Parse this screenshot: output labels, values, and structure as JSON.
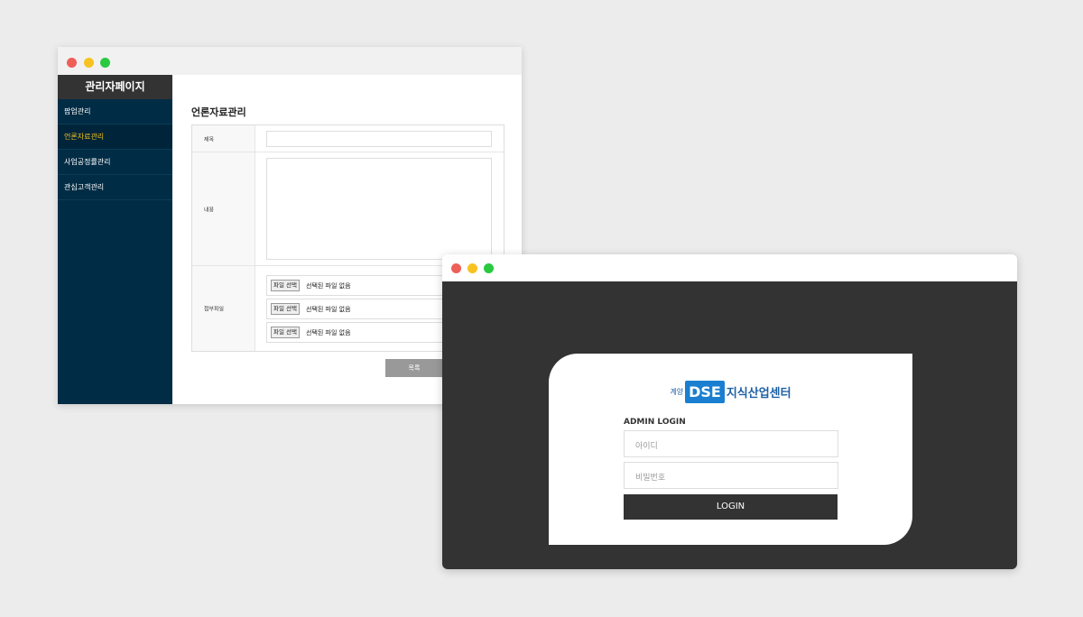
{
  "colors": {
    "dot_red": "#ee5f57",
    "dot_yellow": "#f8c220",
    "dot_green": "#29c940",
    "sidebar_bg": "#012c45",
    "active_menu": "#f6c21a"
  },
  "admin": {
    "sidebar": {
      "title": "관리자페이지",
      "items": [
        {
          "label": "팝업관리",
          "active": false
        },
        {
          "label": "언론자료관리",
          "active": true
        },
        {
          "label": "사업공정률관리",
          "active": false
        },
        {
          "label": "관심고객관리",
          "active": false
        }
      ]
    },
    "page_title": "언론자료관리",
    "form": {
      "title_label": "제목",
      "content_label": "내용",
      "attach_label": "첨부파일",
      "files": [
        {
          "button": "파일 선택",
          "status": "선택된 파일 없음"
        },
        {
          "button": "파일 선택",
          "status": "선택된 파일 없음"
        },
        {
          "button": "파일 선택",
          "status": "선택된 파일 없음"
        }
      ]
    },
    "list_button": "목록"
  },
  "login": {
    "logo": {
      "prefix": "계양",
      "mark": "DSE",
      "name": "지식산업센터"
    },
    "heading": "ADMIN LOGIN",
    "id_placeholder": "아이디",
    "pw_placeholder": "비밀번호",
    "button": "LOGIN"
  }
}
